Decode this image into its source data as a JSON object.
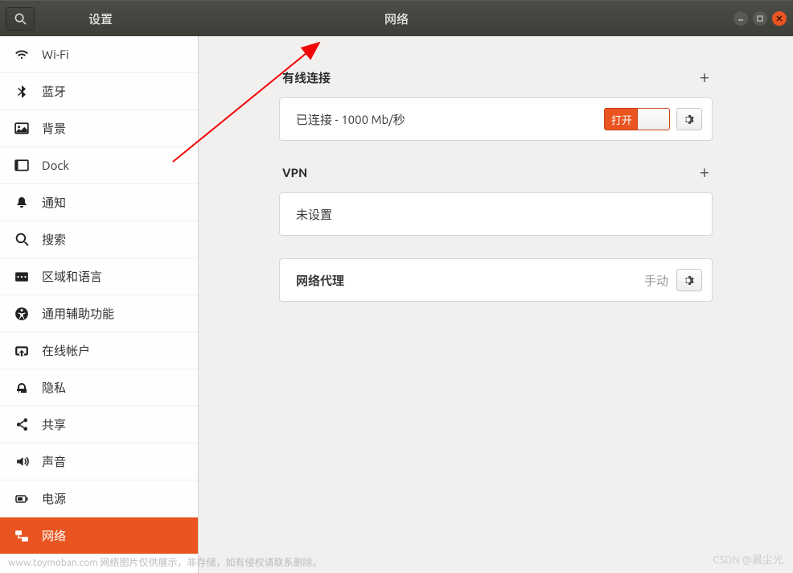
{
  "titlebar": {
    "left_title": "设置",
    "center_title": "网络"
  },
  "sidebar": {
    "items": [
      {
        "id": "wifi",
        "label": "Wi-Fi"
      },
      {
        "id": "bluetooth",
        "label": "蓝牙"
      },
      {
        "id": "background",
        "label": "背景"
      },
      {
        "id": "dock",
        "label": "Dock"
      },
      {
        "id": "notifications",
        "label": "通知"
      },
      {
        "id": "search",
        "label": "搜索"
      },
      {
        "id": "region",
        "label": "区域和语言"
      },
      {
        "id": "accessibility",
        "label": "通用辅助功能"
      },
      {
        "id": "online-accounts",
        "label": "在线帐户"
      },
      {
        "id": "privacy",
        "label": "隐私"
      },
      {
        "id": "sharing",
        "label": "共享"
      },
      {
        "id": "sound",
        "label": "声音"
      },
      {
        "id": "power",
        "label": "电源"
      },
      {
        "id": "network",
        "label": "网络",
        "active": true
      }
    ]
  },
  "content": {
    "wired": {
      "title": "有线连接",
      "status": "已连接 - 1000 Mb/秒",
      "toggle_label": "打开"
    },
    "vpn": {
      "title": "VPN",
      "status": "未设置"
    },
    "proxy": {
      "title": "网络代理",
      "mode": "手动"
    }
  },
  "footer": {
    "left": "www.toymoban.com 网络图片仅供展示，非存储，如有侵权请联系删除。",
    "right": "CSDN @晨尘光"
  }
}
